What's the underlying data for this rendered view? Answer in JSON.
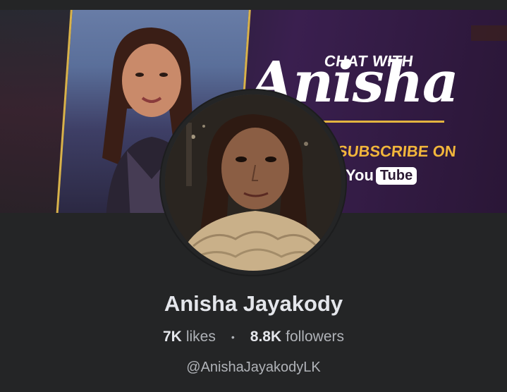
{
  "cover": {
    "chat_with": "CHAT WITH",
    "anisha_script": "Anisha",
    "subscribe": "SUBSCRIBE ON",
    "yt_you": "You",
    "yt_tube": "Tube"
  },
  "profile": {
    "name": "Anisha Jayakody",
    "likes_count": "7K",
    "likes_label": "likes",
    "followers_count": "8.8K",
    "followers_label": "followers",
    "separator": "•",
    "handle": "@AnishaJayakodyLK"
  },
  "colors": {
    "background": "#242526",
    "primary_text": "#e4e6eb",
    "secondary_text": "#b0b3b8",
    "accent_gold": "#e3b440"
  }
}
